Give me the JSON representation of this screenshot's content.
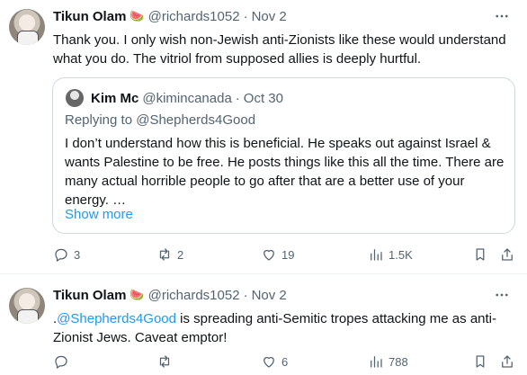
{
  "tweets": [
    {
      "author_name": "Tikun Olam",
      "emoji": "🍉",
      "handle": "@richards1052",
      "dot": "·",
      "date": "Nov 2",
      "text": "Thank you. I only wish non-Jewish anti-Zionists like these would understand what you do. The vitriol from supposed allies is deeply hurtful.",
      "quote": {
        "author_name": "Kim Mc",
        "handle": "@kimincanada",
        "dot": "·",
        "date": "Oct 30",
        "replying_prefix": "Replying to ",
        "replying_to": "@Shepherds4Good",
        "text": "I don’t understand how this is beneficial. He speaks out against Israel & wants Palestine to be free. He posts things like this all the time. There are many actual horrible people to go after that are a better use of your energy. …",
        "show_more": "Show more"
      },
      "actions": {
        "replies": "3",
        "reposts": "2",
        "likes": "19",
        "views": "1.5K"
      }
    },
    {
      "author_name": "Tikun Olam",
      "emoji": "🍉",
      "handle": "@richards1052",
      "dot": "·",
      "date": "Nov 2",
      "text_prefix": ".",
      "mention": "@Shepherds4Good",
      "text_rest": " is spreading anti-Semitic tropes attacking me as anti-Zionist Jews.  Caveat emptor!",
      "actions": {
        "replies": "",
        "reposts": "",
        "likes": "6",
        "views": "788"
      }
    }
  ],
  "icons": {
    "more": "more-dots-icon",
    "reply": "reply-bubble-icon",
    "repost": "repost-arrows-icon",
    "like": "heart-icon",
    "views": "views-bars-icon",
    "share": "share-upload-icon"
  }
}
